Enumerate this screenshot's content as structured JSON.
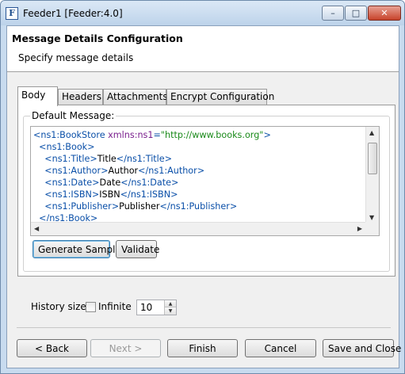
{
  "window": {
    "title": "Feeder1 [Feeder:4.0]",
    "app_icon_letter": "F"
  },
  "header": {
    "title": "Message Details Configuration",
    "subtitle": "Specify message details"
  },
  "tabs": [
    {
      "label": "Body",
      "active": true
    },
    {
      "label": "Headers",
      "active": false
    },
    {
      "label": "Attachments",
      "active": false
    },
    {
      "label": "Encrypt Configuration",
      "active": false
    }
  ],
  "body": {
    "group_label": "Default Message:",
    "xml_lines": [
      {
        "indent": "",
        "parts": [
          {
            "t": "<ns1:BookStore ",
            "c": "tg"
          },
          {
            "t": "xmlns:ns1",
            "c": "at"
          },
          {
            "t": "=",
            "c": "tg"
          },
          {
            "t": "\"http://www.books.org\"",
            "c": "st"
          },
          {
            "t": ">",
            "c": "tg"
          }
        ]
      },
      {
        "indent": "  ",
        "parts": [
          {
            "t": "<ns1:Book>",
            "c": "tg"
          }
        ]
      },
      {
        "indent": "    ",
        "parts": [
          {
            "t": "<ns1:Title>",
            "c": "tg"
          },
          {
            "t": "Title",
            "c": ""
          },
          {
            "t": "</ns1:Title>",
            "c": "tg"
          }
        ]
      },
      {
        "indent": "    ",
        "parts": [
          {
            "t": "<ns1:Author>",
            "c": "tg"
          },
          {
            "t": "Author",
            "c": ""
          },
          {
            "t": "</ns1:Author>",
            "c": "tg"
          }
        ]
      },
      {
        "indent": "    ",
        "parts": [
          {
            "t": "<ns1:Date>",
            "c": "tg"
          },
          {
            "t": "Date",
            "c": ""
          },
          {
            "t": "</ns1:Date>",
            "c": "tg"
          }
        ]
      },
      {
        "indent": "    ",
        "parts": [
          {
            "t": "<ns1:ISBN>",
            "c": "tg"
          },
          {
            "t": "ISBN",
            "c": ""
          },
          {
            "t": "</ns1:ISBN>",
            "c": "tg"
          }
        ]
      },
      {
        "indent": "    ",
        "parts": [
          {
            "t": "<ns1:Publisher>",
            "c": "tg"
          },
          {
            "t": "Publisher",
            "c": ""
          },
          {
            "t": "</ns1:Publisher>",
            "c": "tg"
          }
        ]
      },
      {
        "indent": "  ",
        "parts": [
          {
            "t": "</ns1:Book>",
            "c": "tg"
          }
        ]
      }
    ],
    "generate_sample_label": "Generate Sample",
    "validate_label": "Validate"
  },
  "history": {
    "label": "History size:",
    "infinite_label": "Infinite",
    "infinite_checked": false,
    "value": "10"
  },
  "footer": {
    "back_label": "< Back",
    "next_label": "Next >",
    "finish_label": "Finish",
    "cancel_label": "Cancel",
    "save_close_label": "Save and Close"
  },
  "colors": {
    "xml_tag": "#0a4fa8",
    "xml_attr": "#7a1f8e",
    "xml_string": "#1a8a1a"
  }
}
